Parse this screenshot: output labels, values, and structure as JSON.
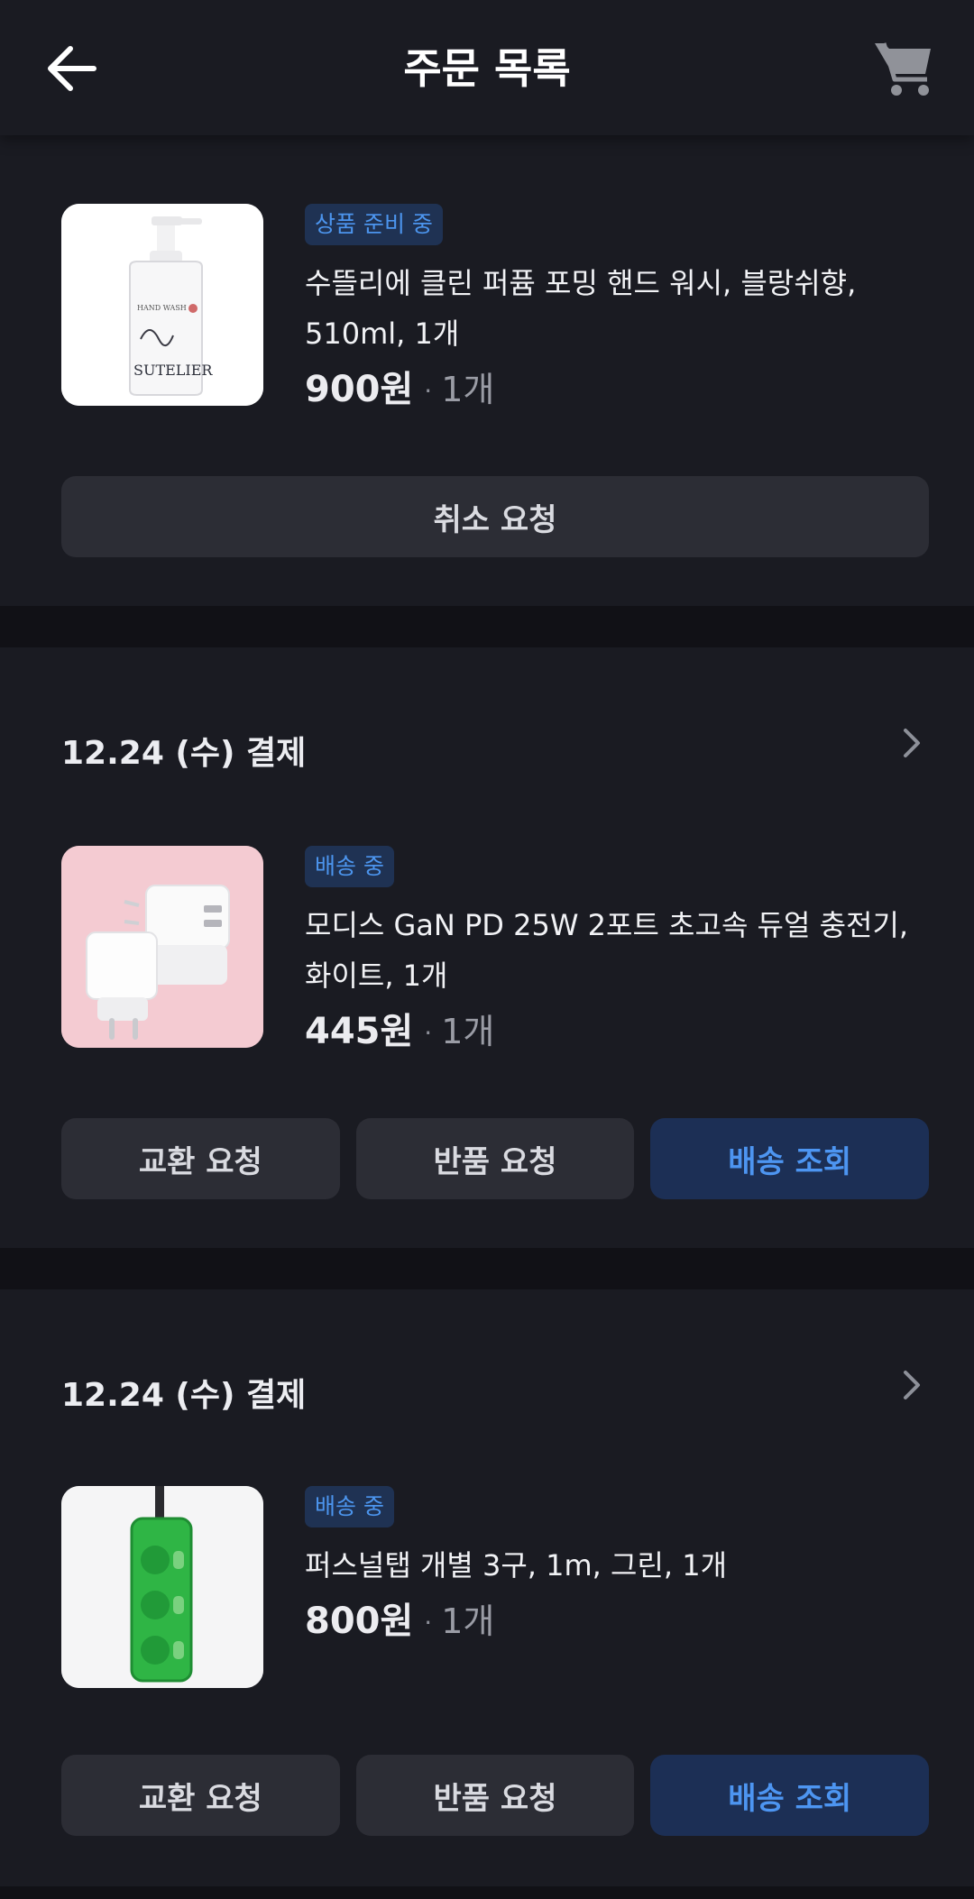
{
  "header": {
    "title": "주문 목록",
    "back_icon": "arrow-left-icon",
    "cart_icon": "cart-icon"
  },
  "colors": {
    "background": "#111116",
    "card": "#1a1b22",
    "accent": "#4d95f1",
    "badge_bg": "#1f3253",
    "button_bg": "#2c2d35",
    "primary_button_bg": "#1c2f55"
  },
  "orders": [
    {
      "status": "상품 준비 중",
      "name": "수뜰리에 클린 퍼퓸 포밍 핸드 워시, 블랑쉬향, 510ml, 1개",
      "price": "900원",
      "separator": "·",
      "qty": "1개",
      "image": "hand-wash-bottle",
      "buttons": {
        "cancel": "취소 요청"
      }
    },
    {
      "date": "12.24 (수) 결제",
      "status": "배송 중",
      "name": "모디스 GaN PD 25W 2포트 초고속 듀얼 충전기, 화이트, 1개",
      "price": "445원",
      "separator": "·",
      "qty": "1개",
      "image": "usb-charger",
      "buttons": {
        "exchange": "교환 요청",
        "return": "반품 요청",
        "track": "배송 조회"
      }
    },
    {
      "date": "12.24 (수) 결제",
      "status": "배송 중",
      "name": "퍼스널탭 개별 3구, 1m, 그린, 1개",
      "price": "800원",
      "separator": "·",
      "qty": "1개",
      "image": "power-strip",
      "buttons": {
        "exchange": "교환 요청",
        "return": "반품 요청",
        "track": "배송 조회"
      }
    }
  ]
}
